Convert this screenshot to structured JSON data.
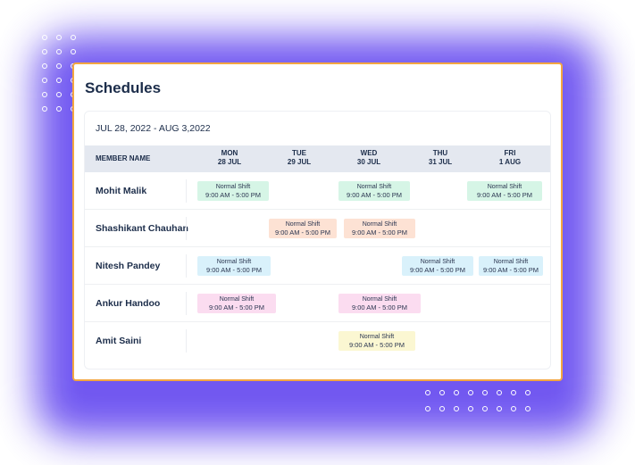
{
  "app": {
    "title": "Schedules"
  },
  "range": "JUL 28, 2022 - AUG 3,2022",
  "header": {
    "member_col": "MEMBER NAME",
    "days": [
      {
        "day": "MON",
        "date": "28 JUL"
      },
      {
        "day": "TUE",
        "date": "29 JUL"
      },
      {
        "day": "WED",
        "date": "30 JUL"
      },
      {
        "day": "THU",
        "date": "31 JUL"
      },
      {
        "day": "FRI",
        "date": "1 AUG"
      }
    ]
  },
  "shift_colors": {
    "green": "#d6f5e6",
    "orange": "#fde2d4",
    "blue": "#d9f1fb",
    "pink": "#fbdcf0",
    "yellow": "#fbf7d2"
  },
  "members": [
    {
      "name": "Mohit Malik",
      "shifts": [
        {
          "day": "MON",
          "label": "Normal Shift",
          "time": "9:00 AM - 5:00 PM",
          "color": "green"
        },
        {
          "day": "WED",
          "label": "Normal Shift",
          "time": "9:00 AM - 5:00 PM",
          "color": "green"
        },
        {
          "day": "FRI",
          "label": "Normal Shift",
          "time": "9:00 AM - 5:00 PM",
          "color": "green"
        }
      ]
    },
    {
      "name": "Shashikant Chauhan",
      "shifts": [
        {
          "day": "TUE",
          "label": "Normal Shift",
          "time": "9:00 AM - 5:00 PM",
          "color": "orange"
        },
        {
          "day": "WED",
          "label": "Normal Shift",
          "time": "9:00 AM - 5:00 PM",
          "color": "orange"
        }
      ]
    },
    {
      "name": "Nitesh Pandey",
      "shifts": [
        {
          "day": "MON",
          "label": "Normal Shift",
          "time": "9:00 AM - 5:00 PM",
          "color": "blue"
        },
        {
          "day": "THU",
          "label": "Normal Shift",
          "time": "9:00 AM - 5:00 PM",
          "color": "blue"
        },
        {
          "day": "FRI",
          "label": "Normal Shift",
          "time": "9:00 AM - 5:00 PM",
          "color": "blue"
        }
      ]
    },
    {
      "name": "Ankur Handoo",
      "shifts": [
        {
          "day": "MON",
          "label": "Normal Shift",
          "time": "9:00 AM - 5:00 PM",
          "color": "pink"
        },
        {
          "day": "WED",
          "label": "Normal Shift",
          "time": "9:00 AM - 5:00 PM",
          "color": "pink"
        }
      ]
    },
    {
      "name": "Amit Saini",
      "shifts": [
        {
          "day": "WED",
          "label": "Normal Shift",
          "time": "9:00 AM - 5:00 PM",
          "color": "yellow"
        }
      ]
    }
  ]
}
